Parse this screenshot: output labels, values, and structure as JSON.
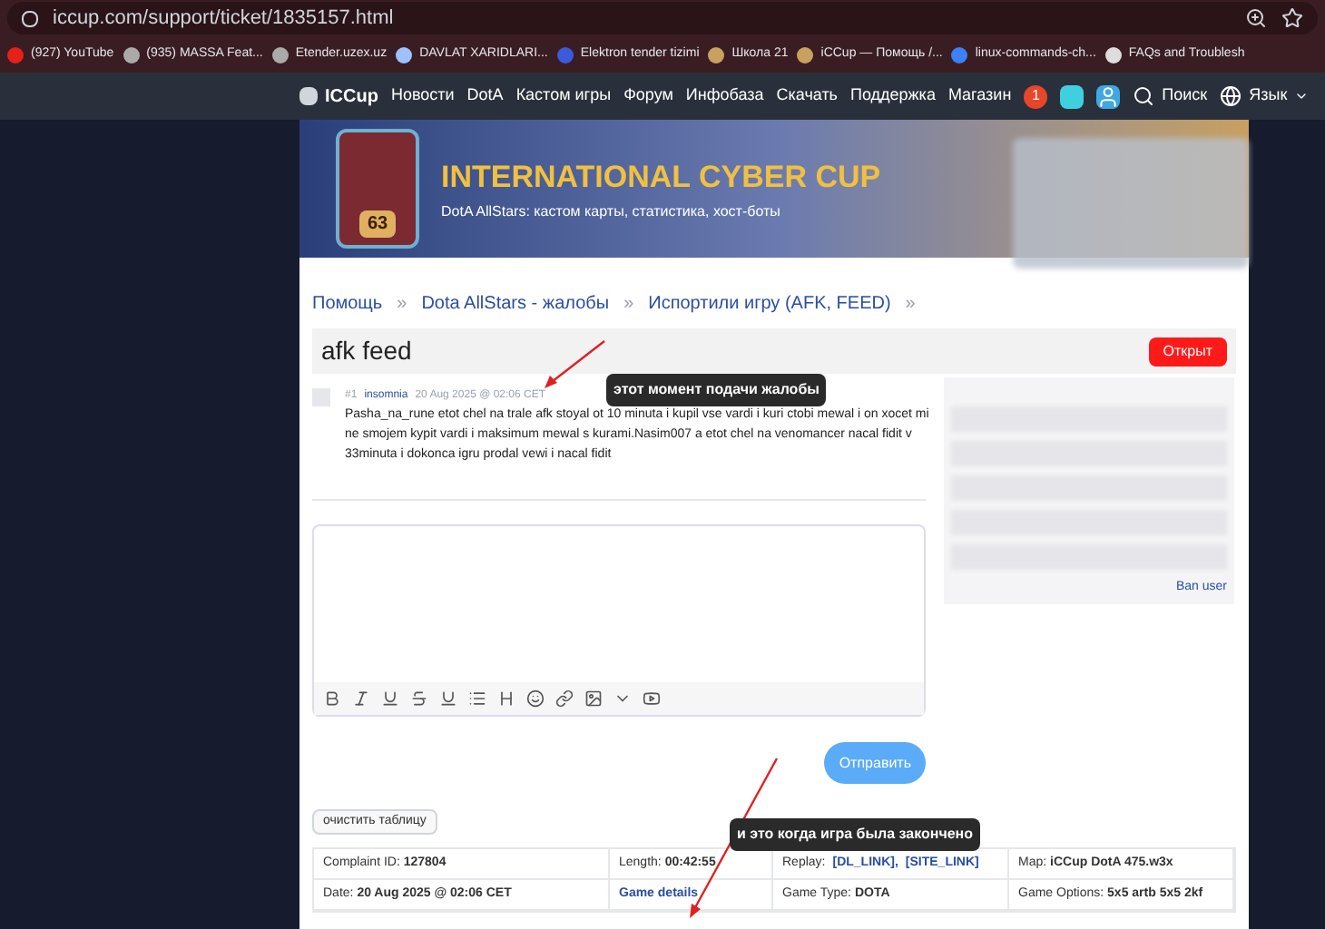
{
  "browser": {
    "url": "iccup.com/support/ticket/1835157.html",
    "bookmarks": [
      {
        "label": "(927) YouTube"
      },
      {
        "label": "(935) MASSA Feat..."
      },
      {
        "label": "Etender.uzex.uz"
      },
      {
        "label": "DAVLAT XARIDLARI..."
      },
      {
        "label": "Elektron tender tizimi"
      },
      {
        "label": "Школа 21"
      },
      {
        "label": "iCCup — Помощь /..."
      },
      {
        "label": "linux-commands-ch..."
      },
      {
        "label": "FAQs and Troublesh"
      }
    ]
  },
  "nav": {
    "logo": "ICCup",
    "items": [
      "Новости",
      "DotA",
      "Кастом игры",
      "Форум",
      "Инфобаза",
      "Скачать",
      "Поддержка",
      "Магазин"
    ],
    "notifications": "1",
    "search": "Поиск",
    "language": "Язык"
  },
  "banner": {
    "title": "INTERNATIONAL CYBER CUP",
    "subtitle": "DotA AllStars: кастом карты, статистика, хост-боты",
    "level": "63"
  },
  "breadcrumbs": [
    {
      "label": "Помощь",
      "separator": "»"
    },
    {
      "label": "Dota AllStars - жалобы",
      "separator": "»"
    },
    {
      "label": "Испортили игру (AFK, FEED)",
      "separator": "»"
    }
  ],
  "ticket": {
    "title": "afk feed",
    "status": "Открыт"
  },
  "post": {
    "number": "#1",
    "author": "insomnia",
    "date": "20 Aug 2025 @ 02:06 CET",
    "text": "Pasha_na_rune etot chel na trale afk stoyal ot 10 minuta i kupil vse vardi i kuri ctobi mewal i on xocet mi ne smojem kypit vardi i maksimum mewal s kurami.Nasim007 a etot chel na venomancer nacal fidit v 33minuta i dokonca igru prodal vewi i nacal fidit"
  },
  "sidebar": {
    "ban": "Ban user"
  },
  "editor": {
    "send": "Отправить"
  },
  "clear_button": "очистить таблицу",
  "table": {
    "rows": [
      [
        {
          "kind": "text",
          "text": "Complaint ID: **127804**"
        },
        {
          "kind": "text",
          "text": "Length: **00:42:55**"
        },
        {
          "kind": "links",
          "label": "Replay:",
          "links": [
            "[DL_LINK],",
            "[SITE_LINK]"
          ]
        },
        {
          "kind": "text",
          "text": "Map: **iCCup DotA 475.w3x**"
        }
      ],
      [
        {
          "kind": "text",
          "text": "Date: **20 Aug 2025 @ 02:06 CET**"
        },
        {
          "kind": "links",
          "links": [
            "Game details"
          ]
        },
        {
          "kind": "text",
          "text": "Game Type: **DOTA**"
        },
        {
          "kind": "text",
          "text": "Game Options: **5x5 artb 5x5 2kf**"
        }
      ]
    ]
  },
  "annotations": [
    "этот момент подачи жалобы",
    "и это когда игра была закончено"
  ]
}
